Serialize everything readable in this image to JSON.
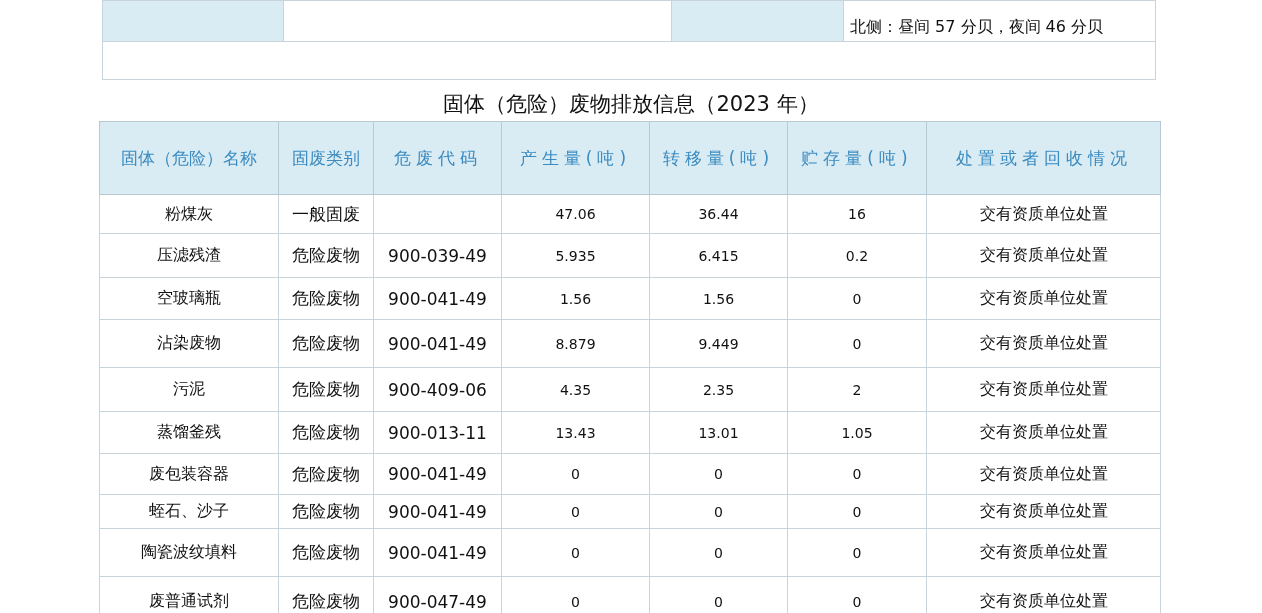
{
  "noise_table": {
    "rows": [
      {
        "cells": [
          {
            "kind": "label",
            "text": ""
          },
          {
            "kind": "value",
            "text": ""
          },
          {
            "kind": "label",
            "text": ""
          },
          {
            "kind": "value",
            "text": "北侧：昼间 57 分贝，夜间 46 分贝"
          }
        ]
      },
      {
        "cells": [
          {
            "kind": "blank",
            "text": ""
          }
        ]
      }
    ]
  },
  "waste_section": {
    "title": "固体（危险）废物排放信息（2023 年）",
    "columns": [
      "固体（危险）名称",
      "固废类别",
      "危废代码",
      "产生量(吨)",
      "转移量(吨)",
      "贮存量(吨)",
      "处置或者回收情况"
    ],
    "rows": [
      [
        "粉煤灰",
        "一般固废",
        "",
        "47.06",
        "36.44",
        "16",
        "交有资质单位处置"
      ],
      [
        "压滤残渣",
        "危险废物",
        "900-039-49",
        "5.935",
        "6.415",
        "0.2",
        "交有资质单位处置"
      ],
      [
        "空玻璃瓶",
        "危险废物",
        "900-041-49",
        "1.56",
        "1.56",
        "0",
        "交有资质单位处置"
      ],
      [
        "沾染废物",
        "危险废物",
        "900-041-49",
        "8.879",
        "9.449",
        "0",
        "交有资质单位处置"
      ],
      [
        "污泥",
        "危险废物",
        "900-409-06",
        "4.35",
        "2.35",
        "2",
        "交有资质单位处置"
      ],
      [
        "蒸馏釜残",
        "危险废物",
        "900-013-11",
        "13.43",
        "13.01",
        "1.05",
        "交有资质单位处置"
      ],
      [
        "废包装容器",
        "危险废物",
        "900-041-49",
        "0",
        "0",
        "0",
        "交有资质单位处置"
      ],
      [
        "蛭石、沙子",
        "危险废物",
        "900-041-49",
        "0",
        "0",
        "0",
        "交有资质单位处置"
      ],
      [
        "陶瓷波纹填料",
        "危险废物",
        "900-041-49",
        "0",
        "0",
        "0",
        "交有资质单位处置"
      ],
      [
        "废普通试剂",
        "危险废物",
        "900-047-49",
        "0",
        "0",
        "0",
        "交有资质单位处置"
      ]
    ]
  }
}
